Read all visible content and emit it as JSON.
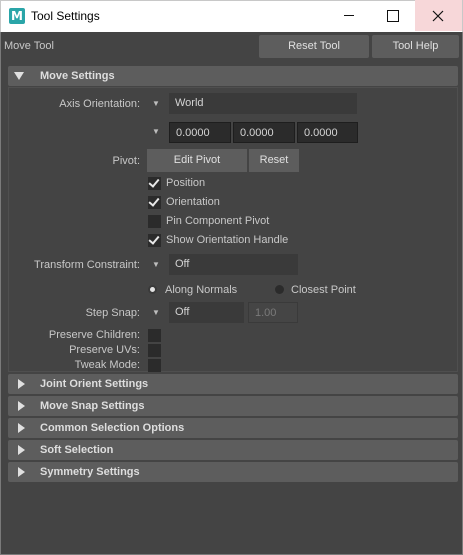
{
  "window": {
    "app_icon_letter": "M",
    "title": "Tool Settings",
    "minimize": "minimize-icon",
    "maximize": "maximize-icon",
    "close": "close-icon"
  },
  "toolbar": {
    "tool_name": "Move Tool",
    "reset_tool_label": "Reset Tool",
    "tool_help_label": "Tool Help"
  },
  "move_settings": {
    "header": "Move Settings",
    "axis_orientation_label": "Axis Orientation:",
    "axis_orientation_value": "World",
    "axis_values": [
      "0.0000",
      "0.0000",
      "0.0000"
    ],
    "pivot_label": "Pivot:",
    "edit_pivot_label": "Edit Pivot",
    "reset_label": "Reset",
    "checkboxes": [
      {
        "label": "Position",
        "checked": true
      },
      {
        "label": "Orientation",
        "checked": true
      },
      {
        "label": "Pin Component Pivot",
        "checked": false
      },
      {
        "label": "Show Orientation Handle",
        "checked": true
      }
    ],
    "transform_constraint_label": "Transform Constraint:",
    "transform_constraint_value": "Off",
    "along_normals_label": "Along Normals",
    "closest_point_label": "Closest Point",
    "along_normals_selected": true,
    "step_snap_label": "Step Snap:",
    "step_snap_value": "Off",
    "step_snap_amount": "1.00",
    "preserve_children_label": "Preserve Children:",
    "preserve_uvs_label": "Preserve UVs:",
    "tweak_mode_label": "Tweak Mode:"
  },
  "collapsed_sections": [
    "Joint Orient Settings",
    "Move Snap Settings",
    "Common Selection Options",
    "Soft Selection",
    "Symmetry Settings"
  ],
  "colors": {
    "background": "#444444",
    "section_header": "#5d5d5d",
    "field": "#2b2b2b",
    "app_icon": "#2aa5a8",
    "close_hover": "#f7d7d9"
  }
}
